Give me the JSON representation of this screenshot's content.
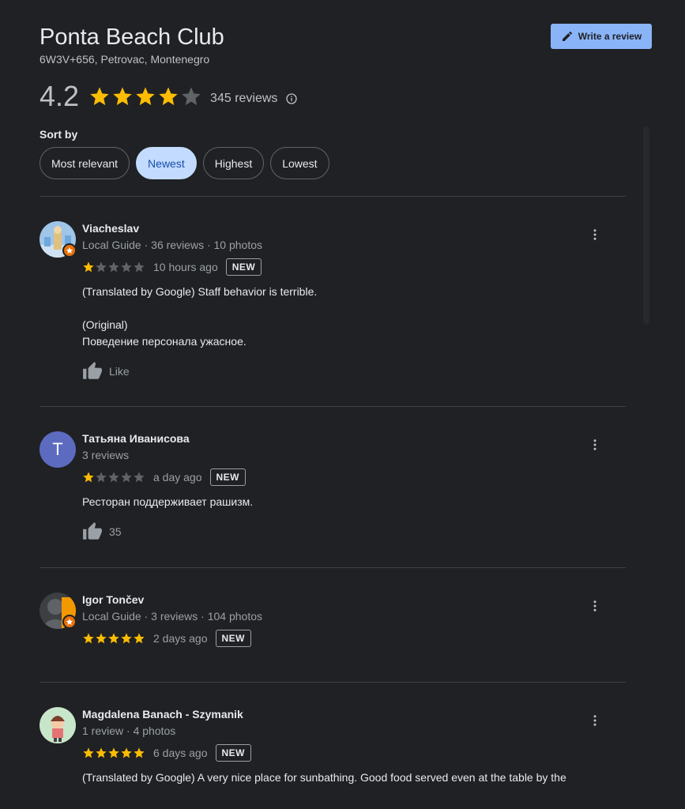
{
  "place": {
    "title": "Ponta Beach Club",
    "address": "6W3V+656, Petrovac, Montenegro"
  },
  "write_review_label": "Write a review",
  "rating": {
    "value": "4.2",
    "stars": 4,
    "count_label": "345 reviews"
  },
  "sort": {
    "label": "Sort by",
    "options": [
      "Most relevant",
      "Newest",
      "Highest",
      "Lowest"
    ],
    "selected": "Newest"
  },
  "reviews": [
    {
      "name": "Viacheslav",
      "meta": "Local Guide · 36 reviews · 10 photos",
      "rating": 1,
      "time": "10 hours ago",
      "badge": "NEW",
      "text": "(Translated by Google) Staff behavior is terrible.\n\n(Original)\nПоведение персонала ужасное.",
      "like": "Like"
    },
    {
      "name": "Татьяна Иванисова",
      "avatar_letter": "T",
      "meta": "3 reviews",
      "rating": 1,
      "time": "a day ago",
      "badge": "NEW",
      "text": "Ресторан поддерживает рашизм.",
      "like": "35"
    },
    {
      "name": "Igor Tončev",
      "meta": "Local Guide · 3 reviews · 104 photos",
      "rating": 5,
      "time": "2 days ago",
      "badge": "NEW"
    },
    {
      "name": "Magdalena Banach - Szymanik",
      "meta": "1 review · 4 photos",
      "rating": 5,
      "time": "6 days ago",
      "badge": "NEW",
      "text": "(Translated by Google) A very nice place for sunbathing. Good food served even at the table by the"
    }
  ],
  "colors": {
    "background": "#202124",
    "star": "#fbbc04",
    "star_empty": "#5f6368",
    "accent": "#8ab4f8",
    "chip_active": "#c2dbff"
  }
}
